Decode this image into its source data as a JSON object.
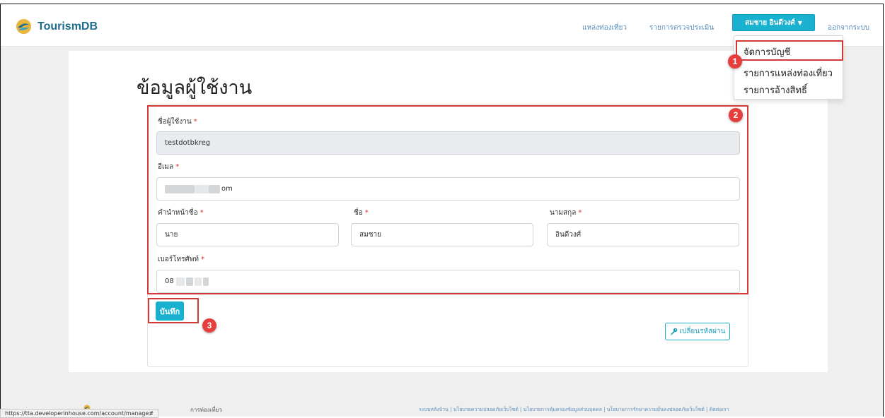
{
  "brand": {
    "name": "TourismDB"
  },
  "nav": {
    "links": [
      "แหล่งท่องเที่ยว",
      "รายการตรวจประเมิน"
    ],
    "user_name": "สมชาย อินดีวงศ์",
    "logout": "ออกจากระบบ"
  },
  "dropdown": {
    "items": [
      "จัดการบัญชี",
      "รายการแหล่งท่องเที่ยว",
      "รายการอ้างสิทธิ์"
    ]
  },
  "page": {
    "title": "ข้อมูลผู้ใช้งาน"
  },
  "form": {
    "username": {
      "label": "ชื่อผู้ใช้งาน",
      "value": "testdotbkreg"
    },
    "email": {
      "label": "อีเมล",
      "value_visible": "om"
    },
    "prefix": {
      "label": "คำนำหน้าชื่อ",
      "value": "นาย"
    },
    "first_name": {
      "label": "ชื่อ",
      "value": "สมชาย"
    },
    "last_name": {
      "label": "นามสกุล",
      "value": "อินดีวงศ์"
    },
    "phone": {
      "label": "เบอร์โทรศัพท์",
      "value_visible": "08"
    },
    "required_mark": "*"
  },
  "buttons": {
    "save": "บันทึก",
    "change_password": "เปลี่ยนรหัสผ่าน"
  },
  "markers": [
    "1",
    "2",
    "3"
  ],
  "footer": {
    "left_text": "การท่องเที่ยว",
    "links": "ระบบหลังบ้าน | นโยบายความปลอดภัยเว็บไซต์ | นโยบายการคุ้มครองข้อมูลส่วนบุคคล | นโยบายการรักษาความมั่นคงปลอดภัยเว็บไซต์ | ติดต่อเรา"
  },
  "status_bar": {
    "url": "https://tta.developerinhouse.com/account/manage#"
  },
  "colors": {
    "accent": "#1ab0cf",
    "highlight": "#d23a3a",
    "marker": "#e63d3d",
    "required": "#d9302c"
  }
}
